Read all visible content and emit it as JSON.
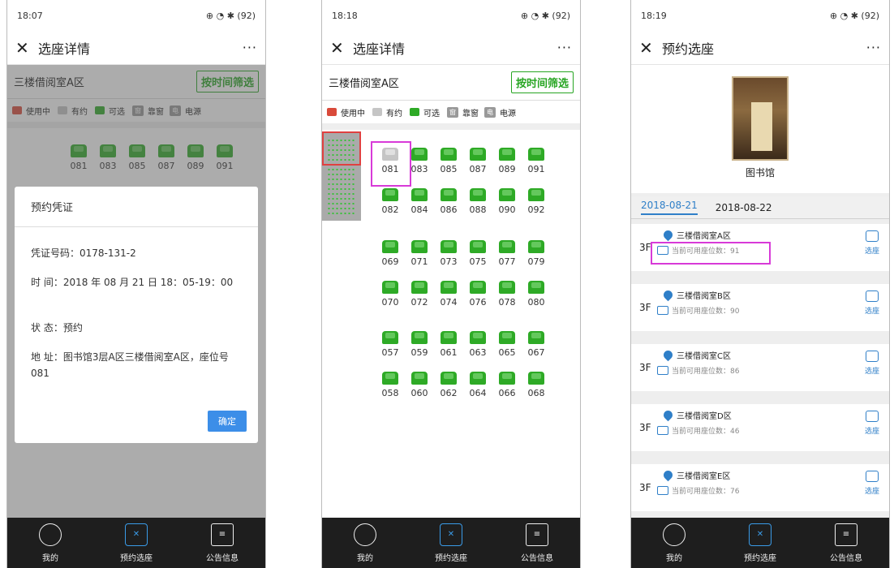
{
  "status": {
    "p1_time": "18:07",
    "p2_time": "18:18",
    "p3_time": "18:19",
    "right": "⊕ ◔ ✱ (92)"
  },
  "p1": {
    "title": "选座详情",
    "area": "三楼借阅室A区",
    "filter": "按时间筛选",
    "seats": [
      "081",
      "083",
      "085",
      "087",
      "089",
      "091"
    ],
    "dialog": {
      "title": "预约凭证",
      "code": "凭证号码：0178-131-2",
      "time": "时 间：2018 年 08 月 21 日 18：05-19：00",
      "state": "状 态：预约",
      "addr": "地 址：图书馆3层A区三楼借阅室A区，座位号081",
      "ok": "确定"
    }
  },
  "legend": {
    "inuse": "使用中",
    "reserved": "有约",
    "available": "可选",
    "window": "靠窗",
    "power": "电源",
    "window_glyph": "窗",
    "power_glyph": "电"
  },
  "p2": {
    "title": "选座详情",
    "area": "三楼借阅室A区",
    "filter": "按时间筛选",
    "rows": [
      [
        "081",
        "083",
        "085",
        "087",
        "089",
        "091"
      ],
      [
        "082",
        "084",
        "086",
        "088",
        "090",
        "092"
      ],
      [
        "069",
        "071",
        "073",
        "075",
        "077",
        "079"
      ],
      [
        "070",
        "072",
        "074",
        "076",
        "078",
        "080"
      ],
      [
        "057",
        "059",
        "061",
        "063",
        "065",
        "067"
      ],
      [
        "058",
        "060",
        "062",
        "064",
        "066",
        "068"
      ]
    ]
  },
  "p3": {
    "title": "预约选座",
    "library": "图书馆",
    "dates": [
      "2018-08-21",
      "2018-08-22"
    ],
    "rooms": [
      {
        "floor": "3F",
        "name": "三楼借阅室A区",
        "count": "当前可用座位数：91",
        "select": "选座"
      },
      {
        "floor": "3F",
        "name": "三楼借阅室B区",
        "count": "当前可用座位数：90",
        "select": "选座"
      },
      {
        "floor": "3F",
        "name": "三楼借阅室C区",
        "count": "当前可用座位数：86",
        "select": "选座"
      },
      {
        "floor": "3F",
        "name": "三楼借阅室D区",
        "count": "当前可用座位数：46",
        "select": "选座"
      },
      {
        "floor": "3F",
        "name": "三楼借阅室E区",
        "count": "当前可用座位数：76",
        "select": "选座"
      }
    ]
  },
  "nav": [
    "我的",
    "预约选座",
    "公告信息"
  ],
  "colors": {
    "available": "#2eaa26",
    "inuse": "#d94a3a",
    "reserved": "#c5c5c5",
    "highlight": "#d83ad8",
    "accent": "#2f7fc8"
  }
}
